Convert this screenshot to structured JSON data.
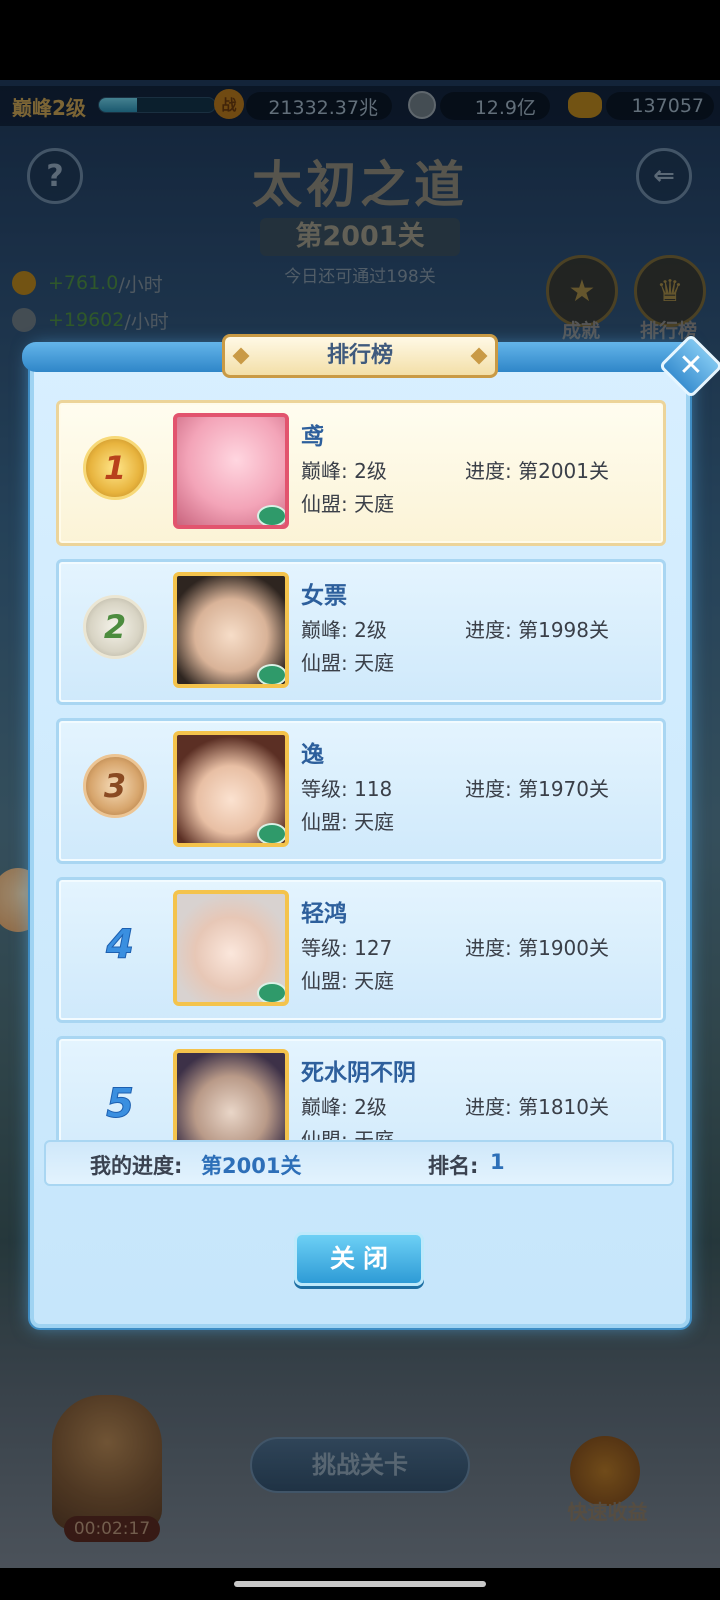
{
  "resources": {
    "peak_level": "巅峰2级",
    "exp_progress": 0.33,
    "battle_power": "21332.37兆",
    "silver": "12.9亿",
    "gold": "137057",
    "battle_icon_glyph": "战"
  },
  "stage": {
    "title": "太初之道",
    "level": "第2001关",
    "remaining": "今日还可通过198关",
    "help_icon": "?",
    "back_icon": "⇐"
  },
  "rates": [
    {
      "value": "+761.0",
      "unit": "/小时"
    },
    {
      "value": "+19602",
      "unit": "/小时"
    }
  ],
  "side_buttons": {
    "achievement": "成就",
    "leaderboard": "排行榜"
  },
  "panel": {
    "title": "排行榜",
    "close_icon": "✕",
    "entries": [
      {
        "rank": "1",
        "name": "鸢",
        "level_label": "巅峰: 2级",
        "progress": "进度: 第2001关",
        "alliance": "仙盟: 天庭"
      },
      {
        "rank": "2",
        "name": "女票",
        "level_label": "巅峰: 2级",
        "progress": "进度: 第1998关",
        "alliance": "仙盟: 天庭"
      },
      {
        "rank": "3",
        "name": "逸",
        "level_label": "等级: 118",
        "progress": "进度: 第1970关",
        "alliance": "仙盟: 天庭"
      },
      {
        "rank": "4",
        "name": "轻鸿",
        "level_label": "等级: 127",
        "progress": "进度: 第1900关",
        "alliance": "仙盟: 天庭"
      },
      {
        "rank": "5",
        "name": "死水阴不阴",
        "level_label": "巅峰: 2级",
        "progress": "进度: 第1810关",
        "alliance": "仙盟: 天庭"
      }
    ],
    "my_progress_label": "我的进度:",
    "my_progress_value": "第2001关",
    "my_rank_label": "排名:",
    "my_rank_value": "1",
    "close_button": "关闭"
  },
  "bottom": {
    "timer": "00:02:17",
    "challenge_button": "挑战关卡",
    "quick_income": "快速收益"
  },
  "colors": {
    "accent_blue": "#2e9bd6",
    "rank_text_blue": "#2d6fb8",
    "first_card_bg": "#fbf3d6",
    "gold": "#e8b43e"
  }
}
